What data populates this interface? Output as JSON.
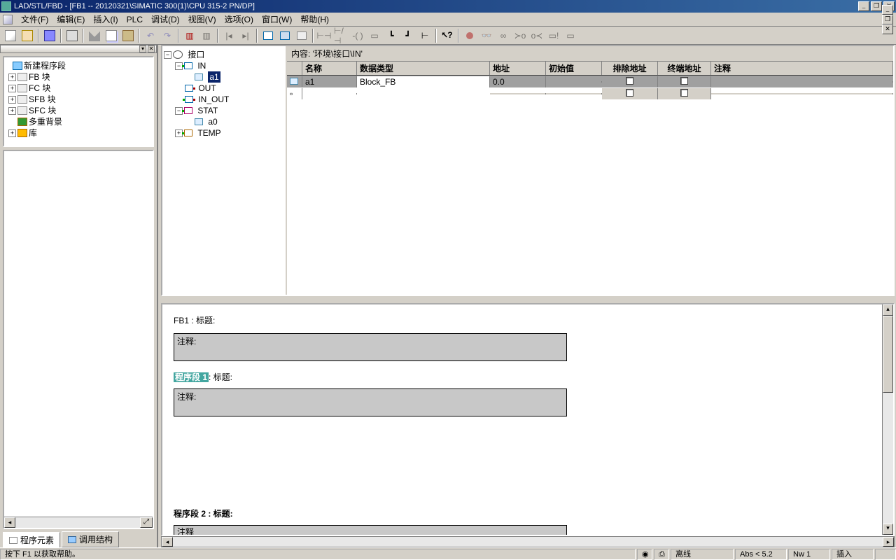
{
  "title": "LAD/STL/FBD  - [FB1 -- 20120321\\SIMATIC 300(1)\\CPU 315-2 PN/DP]",
  "menu": [
    "文件(F)",
    "编辑(E)",
    "插入(I)",
    "PLC",
    "调试(D)",
    "视图(V)",
    "选项(O)",
    "窗口(W)",
    "帮助(H)"
  ],
  "left_tree": {
    "items": [
      {
        "label": "新建程序段"
      },
      {
        "label": "FB 块"
      },
      {
        "label": "FC 块"
      },
      {
        "label": "SFB 块"
      },
      {
        "label": "SFC 块"
      },
      {
        "label": "多重背景"
      },
      {
        "label": "库"
      }
    ]
  },
  "tabs": {
    "t1": "程序元素",
    "t2": "调用结构"
  },
  "mid_tree": {
    "root": "接口",
    "nodes": {
      "in": "IN",
      "a1": "a1",
      "out": "OUT",
      "inout": "IN_OUT",
      "stat": "STAT",
      "a0": "a0",
      "temp": "TEMP"
    }
  },
  "var_panel": {
    "header": "内容:   '环境\\接口\\IN'",
    "cols": {
      "name": "名称",
      "type": "数据类型",
      "addr": "地址",
      "init": "初始值",
      "excl": "排除地址",
      "term": "终端地址",
      "cmt": "注释"
    },
    "row": {
      "name": "a1",
      "type": "Block_FB",
      "addr": "0.0"
    }
  },
  "editor": {
    "block_title": "FB1 : 标题:",
    "comment": "注释:",
    "nw1": "程序段  1",
    "nw1_title": ": 标题:",
    "nw2": "程序段  2 : 标题:",
    "partial": "注释"
  },
  "status": {
    "help": "按下 F1 以获取帮助。",
    "offline": "离线",
    "abs": "Abs < 5.2",
    "nw": "Nw 1",
    "ins": "插入"
  }
}
